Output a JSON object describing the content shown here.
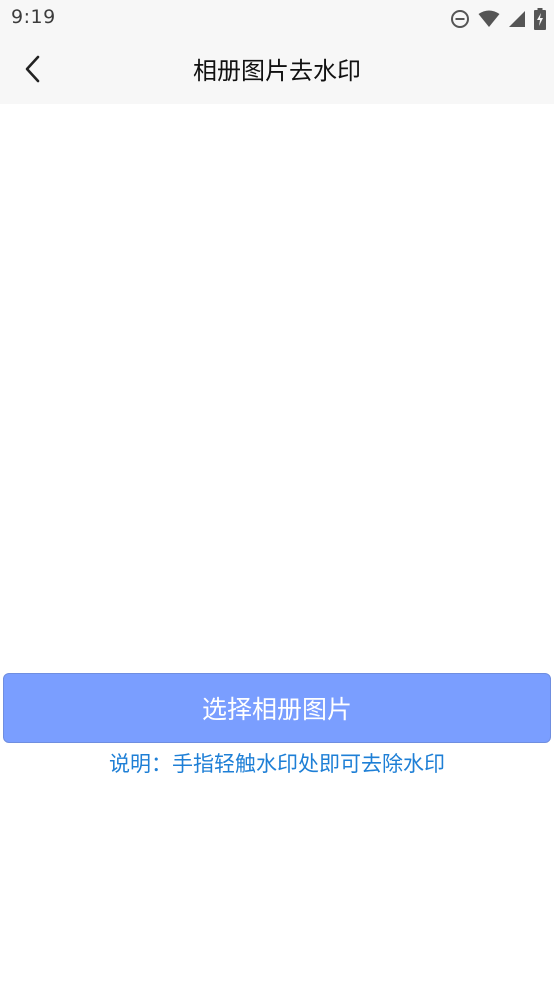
{
  "status_bar": {
    "time": "9:19",
    "icons": [
      "do-not-disturb-icon",
      "wifi-icon",
      "signal-icon",
      "battery-charging-icon"
    ]
  },
  "header": {
    "title": "相册图片去水印",
    "back_icon": "chevron-left-icon"
  },
  "main": {
    "select_button_label": "选择相册图片",
    "hint": "说明：手指轻触水印处即可去除水印"
  },
  "colors": {
    "button_bg": "#7a9eff",
    "hint_text": "#1e7fd6",
    "header_bg": "#f7f7f7"
  }
}
